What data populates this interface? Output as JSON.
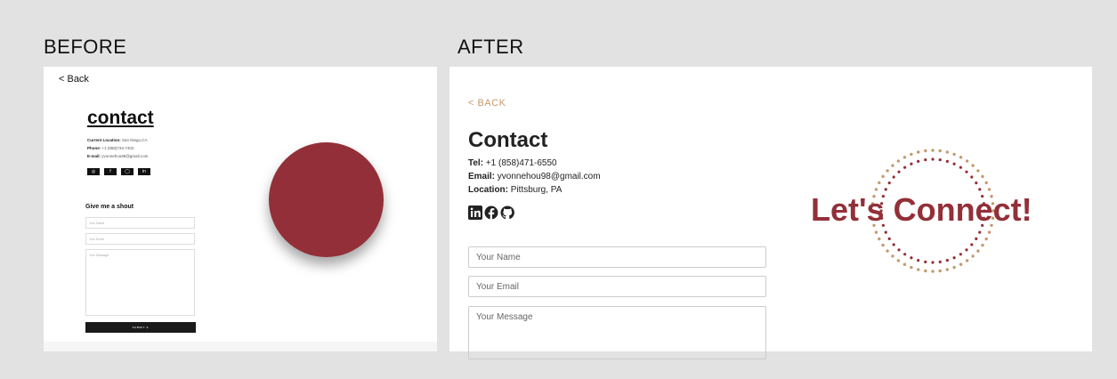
{
  "headings": {
    "before": "BEFORE",
    "after": "AFTER"
  },
  "before": {
    "back": "< Back",
    "title": "contact",
    "info": [
      {
        "label": "Current Location:",
        "value": "San Diego,CA"
      },
      {
        "label": "Phone:",
        "value": "+1 (858)734-7402"
      },
      {
        "label": "E-mail:",
        "value": "yvonnehou98@gmail.com"
      }
    ],
    "social_icons": [
      "instagram-icon",
      "facebook-icon",
      "github-icon",
      "linkedin-icon"
    ],
    "social_glyphs": [
      "◎",
      "f",
      "◯",
      "in"
    ],
    "shout_heading": "Give me a shout",
    "name_placeholder": "Your Name",
    "email_placeholder": "Your Email",
    "message_placeholder": "Your Message",
    "submit_label": "SUBMIT ➤",
    "accent_color": "#932f38"
  },
  "after": {
    "back": "< BACK",
    "title": "Contact",
    "info": [
      {
        "label": "Tel:",
        "value": "+1 (858)471-6550"
      },
      {
        "label": "Email:",
        "value": "yvonnehou98@gmail.com"
      },
      {
        "label": "Location:",
        "value": "Pittsburg, PA"
      }
    ],
    "social_icons": [
      "linkedin-icon",
      "facebook-icon",
      "github-icon"
    ],
    "name_placeholder": "Your Name",
    "email_placeholder": "Your Email",
    "message_placeholder": "Your Message",
    "hero_text": "Let's Connect!",
    "accent_color": "#932f38",
    "secondary_color": "#c49a6c"
  }
}
